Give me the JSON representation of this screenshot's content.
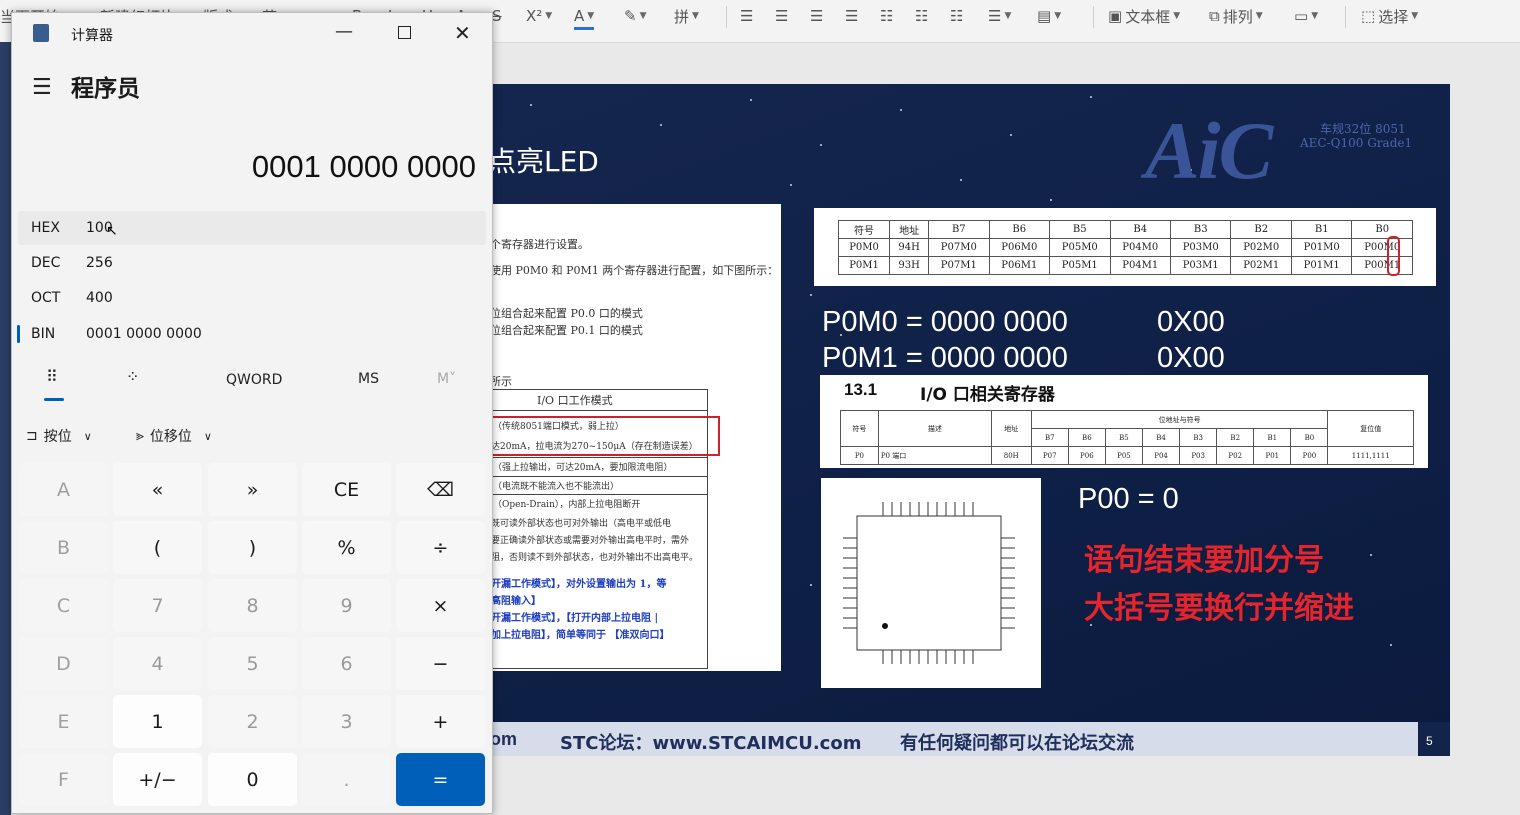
{
  "ribbon": {
    "left_items": [
      "当页开始",
      "新建幻灯片",
      "版式",
      "节"
    ],
    "format_glyphs": [
      "B",
      "I",
      "U",
      "A",
      "S",
      "X²",
      "A",
      "A",
      "拼"
    ],
    "textbox_label": "文本框",
    "arrange_label": "排列",
    "select_label": "选择"
  },
  "calculator": {
    "window_title": "计算器",
    "mode_title": "程序员",
    "display": "0001 0000 0000",
    "radix": [
      {
        "label": "HEX",
        "value": "100"
      },
      {
        "label": "DEC",
        "value": "256"
      },
      {
        "label": "OCT",
        "value": "400"
      },
      {
        "label": "BIN",
        "value": "0001 0000 0000"
      }
    ],
    "selected_radix": "BIN",
    "word_size": "QWORD",
    "memory_store": "MS",
    "memory_menu": "M˅",
    "bitwise_label": "按位",
    "bitshift_label": "位移位",
    "keys": [
      [
        "A",
        "«",
        "»",
        "CE",
        "⌫"
      ],
      [
        "B",
        "(",
        ")",
        "%",
        "÷"
      ],
      [
        "C",
        "7",
        "8",
        "9",
        "×"
      ],
      [
        "D",
        "4",
        "5",
        "6",
        "−"
      ],
      [
        "E",
        "1",
        "2",
        "3",
        "+"
      ],
      [
        "F",
        "+/−",
        "0",
        ".",
        "="
      ]
    ]
  },
  "slide": {
    "title": "点亮LED",
    "logo": "AiC",
    "logo_sub1": "车规32位 8051",
    "logo_sub2": "AEC-Q100 Grade1",
    "doc_text": [
      "个寄存器进行设置。",
      "使用 P0M0 和 P0M1 两个寄存器进行配置，如下图所示：",
      "位组合起来配置 P0.0 口的模式",
      "位组合起来配置 P0.1 口的模式",
      "所示"
    ],
    "io_mode_header": "I/O 口工作模式",
    "io_mode_rows": [
      "（传统8051端口模式，弱上拉）",
      "达20mA，拉电流为270~150μA（存在制造误差）",
      "（强上拉输出，可达20mA，要加限流电阻）",
      "（电流既不能流入也不能流出）",
      "（Open-Drain），内部上拉电阻断开",
      "既可读外部状态也可对外输出（高电平或低电",
      "要正确读外部状态或需要对外输出高电平时，需外",
      "阻，否则读不到外部状态，也对外输出不出高电平。"
    ],
    "io_blue_notes": [
      "开漏工作模式】，对外设置输出为 1，等",
      "高阻输入】",
      "开漏工作模式】，【打开内部上拉电阻 |",
      "加上拉电阻】，简单等同于 【准双向口】"
    ],
    "reg_table": {
      "headers": [
        "符号",
        "地址",
        "B7",
        "B6",
        "B5",
        "B4",
        "B3",
        "B2",
        "B1",
        "B0"
      ],
      "rows": [
        [
          "P0M0",
          "94H",
          "P07M0",
          "P06M0",
          "P05M0",
          "P04M0",
          "P03M0",
          "P02M0",
          "P01M0",
          "P00M0"
        ],
        [
          "P0M1",
          "93H",
          "P07M1",
          "P06M1",
          "P05M1",
          "P04M1",
          "P03M1",
          "P02M1",
          "P01M1",
          "P00M1"
        ]
      ]
    },
    "p0m0_line": "P0M0 = 0000 0000",
    "p0m0_hex": "0X00",
    "p0m1_line": "P0M1 = 0000 0000",
    "p0m1_hex": "0X00",
    "section_num": "13.1",
    "section_title": "I/O 口相关寄存器",
    "io_reg_table": {
      "headers": [
        "符号",
        "描述",
        "地址",
        "位地址与符号",
        "复位值"
      ],
      "bits": [
        "B7",
        "B6",
        "B5",
        "B4",
        "B3",
        "B2",
        "B1",
        "B0"
      ],
      "row": [
        "P0",
        "P0 端口",
        "80H",
        "P07",
        "P06",
        "P05",
        "P04",
        "P03",
        "P02",
        "P01",
        "P00",
        "1111,1111"
      ]
    },
    "p00_line": "P00 = 0",
    "red_note1": "语句结束要加分号",
    "red_note2": "大括号要换行并缩进",
    "footer_url": "om",
    "footer_forum": "STC论坛：www.STCAIMCU.com",
    "footer_tip": "有任何疑问都可以在论坛交流",
    "page_number": "5"
  },
  "colors": {
    "accent": "#005fb8",
    "slide_bg": "#13244b",
    "red": "#e5242c"
  }
}
